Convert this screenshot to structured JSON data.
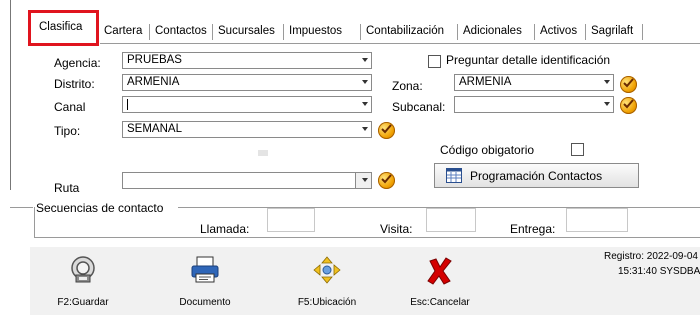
{
  "tabs": [
    {
      "label": "Clasifica",
      "active": true
    },
    {
      "label": "Cartera"
    },
    {
      "label": "Contactos"
    },
    {
      "label": "Sucursales"
    },
    {
      "label": "Impuestos"
    },
    {
      "label": "Contabilización"
    },
    {
      "label": "Adicionales"
    },
    {
      "label": "Activos"
    },
    {
      "label": "Sagrilaft"
    }
  ],
  "form": {
    "agencia": {
      "label": "Agencia:",
      "value": "PRUEBAS"
    },
    "distrito": {
      "label": "Distrito:",
      "value": "ARMENIA"
    },
    "canal": {
      "label": "Canal",
      "value": ""
    },
    "tipo": {
      "label": "Tipo:",
      "value": "SEMANAL"
    },
    "ruta": {
      "label": "Ruta",
      "value": ""
    },
    "zona": {
      "label": "Zona:",
      "value": "ARMENIA"
    },
    "subcanal": {
      "label": "Subcanal:",
      "value": ""
    },
    "preguntar_detalle": {
      "label": "Preguntar detalle identificación",
      "checked": false
    },
    "codigo_obligatorio": {
      "label": "Código obigatorio",
      "checked": false
    },
    "programacion_button": "Programación Contactos"
  },
  "secuencias": {
    "title": "Secuencias de contacto",
    "llamada": "Llamada:",
    "visita": "Visita:",
    "entrega": "Entrega:"
  },
  "toolbar": {
    "guardar": "F2:Guardar",
    "documento": "Documento",
    "ubicacion": "F5:Ubicación",
    "cancelar": "Esc:Cancelar"
  },
  "registro": {
    "line1": "Registro: 2022-09-04",
    "line2": "15:31:40 SYSDBA"
  },
  "colors": {
    "highlight": "#e0141e",
    "check_icon": "#f0a000",
    "cancel_icon": "#d40000"
  },
  "icons": [
    "save-icon",
    "document-icon",
    "location-arrows-icon",
    "cancel-x-icon",
    "checkmark-icon",
    "calendar-grid-icon"
  ]
}
